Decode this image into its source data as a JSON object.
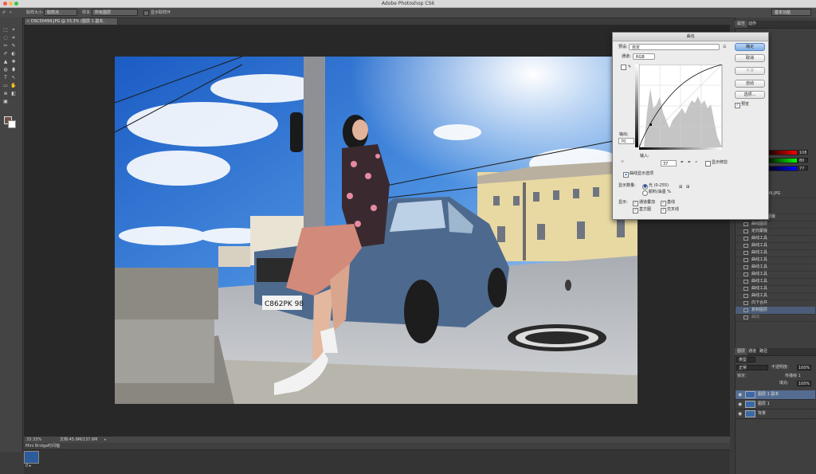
{
  "app": {
    "window_title": "Adobe Photoshop CS6"
  },
  "options_bar": {
    "sample_size_label": "取样大小:",
    "sample_size_value": "取样点",
    "sample_label": "样本:",
    "sample_value": "所有图层",
    "show_ring_label": "显示取样环",
    "workspace": "基本功能"
  },
  "document": {
    "tab_label": "DSC00499.JPG @ 33.3% (图层 1 副本, RGB/8) *",
    "close_glyph": "×"
  },
  "tools": {
    "glyphs": [
      "⬚",
      "⌖",
      "◌",
      "⌗",
      "✂",
      "✎",
      "✐",
      "◐",
      "▲",
      "✚",
      "◍",
      "⬮",
      "T",
      "↖",
      "▭",
      "✋",
      "⊕",
      "◧",
      "▣"
    ]
  },
  "status_bar": {
    "zoom": "33.33%",
    "doc_info": "文档:45.9M/137.6M"
  },
  "bridge": {
    "tab_minibridge": "Mini Bridge",
    "tab_timeline": "时间轴",
    "thumb_label": "0 ▸"
  },
  "curves": {
    "title": "曲线",
    "preset_label": "预设:",
    "preset_value": "自定",
    "channel_label": "通道:",
    "channel_value": "RGB",
    "output_label": "输出:",
    "output_value": "70",
    "input_label": "输入:",
    "input_value": "37",
    "show_clipping_label": "显示修剪",
    "display_options_label": "曲线显示选项",
    "show_amount_label": "显示数量:",
    "amount_light": "光 (0-255)",
    "amount_pigment": "颜料/油墨 %",
    "show_label": "显示:",
    "opt_channel_overlays": "通道叠加",
    "opt_baseline": "基线",
    "opt_histogram": "直方图",
    "opt_intersection": "交叉线",
    "btn_ok": "确定",
    "btn_cancel": "取消",
    "btn_smooth": "平滑",
    "btn_auto": "自动",
    "btn_options": "选项...",
    "preview_label": "预览",
    "grid_glyph_small": "⊞",
    "grid_glyph_large": "⊞"
  },
  "right_panel": {
    "tabs_top": [
      "属性",
      "动作"
    ],
    "color_values": [
      "108",
      "80",
      "77"
    ],
    "history_file": "DSC00499.JPG",
    "history_items": [
      "合并图层",
      "添加图层蒙版",
      "曲线图层",
      "定向蒙版",
      "曲线工具",
      "曲线工具",
      "曲线工具",
      "曲线工具",
      "曲线工具",
      "曲线工具",
      "曲线工具",
      "曲线工具",
      "曲线工具",
      "向下合并",
      "复制图层",
      "曲线"
    ],
    "layers_tabs": [
      "图层",
      "通道",
      "路径"
    ],
    "blend_mode": "正常",
    "opacity_label": "不透明度:",
    "opacity_value": "100%",
    "lock_label": "锁定:",
    "fill_label": "填充:",
    "fill_value": "100%",
    "propagate_label": "传播帧 1",
    "kind_label": "类型",
    "layers": [
      {
        "name": "图层 1 副本",
        "selected": true
      },
      {
        "name": "图层 1",
        "selected": false
      },
      {
        "name": "背景",
        "selected": false
      }
    ]
  },
  "photo": {
    "plate_text": "C862PK 98"
  }
}
